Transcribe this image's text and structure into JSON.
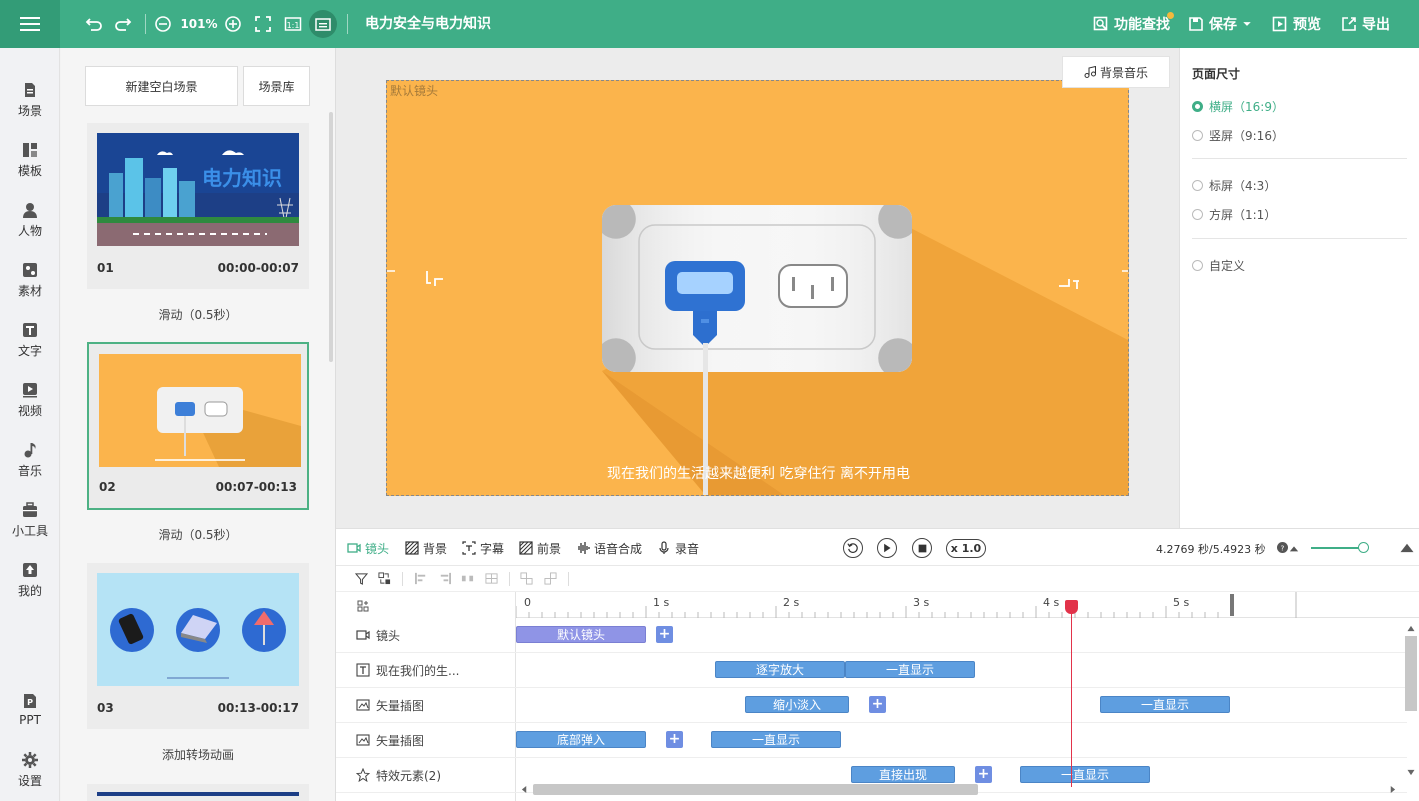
{
  "topbar": {
    "zoom": "101%",
    "title": "电力安全与电力知识",
    "search_label": "功能查找",
    "save_label": "保存",
    "preview_label": "预览",
    "export_label": "导出"
  },
  "nav": [
    {
      "label": "场景",
      "icon": "scene-icon"
    },
    {
      "label": "模板",
      "icon": "template-icon"
    },
    {
      "label": "人物",
      "icon": "person-icon"
    },
    {
      "label": "素材",
      "icon": "material-icon"
    },
    {
      "label": "文字",
      "icon": "text-icon"
    },
    {
      "label": "视频",
      "icon": "video-icon"
    },
    {
      "label": "音乐",
      "icon": "music-icon"
    },
    {
      "label": "小工具",
      "icon": "toolbox-icon"
    },
    {
      "label": "我的",
      "icon": "upload-icon"
    },
    {
      "label": "PPT",
      "icon": "ppt-icon"
    },
    {
      "label": "设置",
      "icon": "gear-icon"
    }
  ],
  "scenes": {
    "new_blank_label": "新建空白场景",
    "library_label": "场景库",
    "thumb1_title": "电力知识",
    "items": [
      {
        "num": "01",
        "time": "00:00-00:07",
        "transition": "滑动（0.5秒）"
      },
      {
        "num": "02",
        "time": "00:07-00:13",
        "transition": "滑动（0.5秒）"
      },
      {
        "num": "03",
        "time": "00:13-00:17",
        "transition": "添加转场动画"
      }
    ]
  },
  "stage": {
    "bgm_label": "背景音乐",
    "lens_label": "默认镜头",
    "subtitle": "现在我们的生活越来越便利 吃穿住行 离不开用电"
  },
  "props": {
    "title": "页面尺寸",
    "options": [
      {
        "label": "横屏（16:9）",
        "selected": true
      },
      {
        "label": "竖屏（9:16）",
        "selected": false
      },
      {
        "label": "标屏（4:3）",
        "selected": false
      },
      {
        "label": "方屏（1:1）",
        "selected": false
      },
      {
        "label": "自定义",
        "selected": false
      }
    ]
  },
  "timeline": {
    "tabs": [
      "镜头",
      "背景",
      "字幕",
      "前景",
      "语音合成",
      "录音"
    ],
    "speed": "x 1.0",
    "time": "4.2769 秒/5.4923 秒",
    "ruler": [
      "0",
      "1 s",
      "2 s",
      "3 s",
      "4 s",
      "5 s"
    ],
    "tracks": [
      {
        "label": "镜头",
        "icon": "camera-icon"
      },
      {
        "label": "现在我们的生...",
        "icon": "text-icon"
      },
      {
        "label": "矢量插图",
        "icon": "image-icon"
      },
      {
        "label": "矢量插图",
        "icon": "image-icon"
      },
      {
        "label": "特效元素(2)",
        "icon": "star-icon"
      }
    ],
    "clips": {
      "lens_default": "默认镜头",
      "text_zoom": "逐字放大",
      "text_show": "一直显示",
      "img1_shrink": "缩小淡入",
      "img1_show": "一直显示",
      "img2_pop": "底部弹入",
      "img2_show": "一直显示",
      "fx_direct": "直接出现",
      "fx_show": "一直显示"
    }
  }
}
